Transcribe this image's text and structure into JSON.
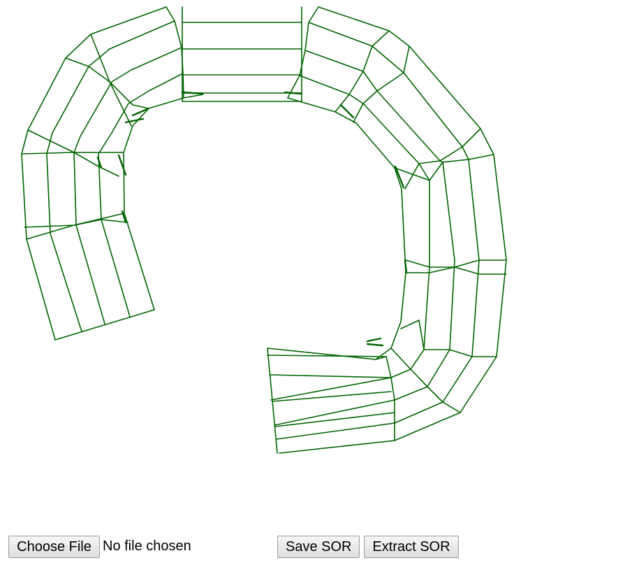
{
  "canvas": {
    "stroke_color": "#006400",
    "background": "#ffffff"
  },
  "controls": {
    "choose_file_label": "Choose File",
    "file_status": "No file chosen",
    "save_label": "Save SOR",
    "extract_label": "Extract SOR"
  }
}
